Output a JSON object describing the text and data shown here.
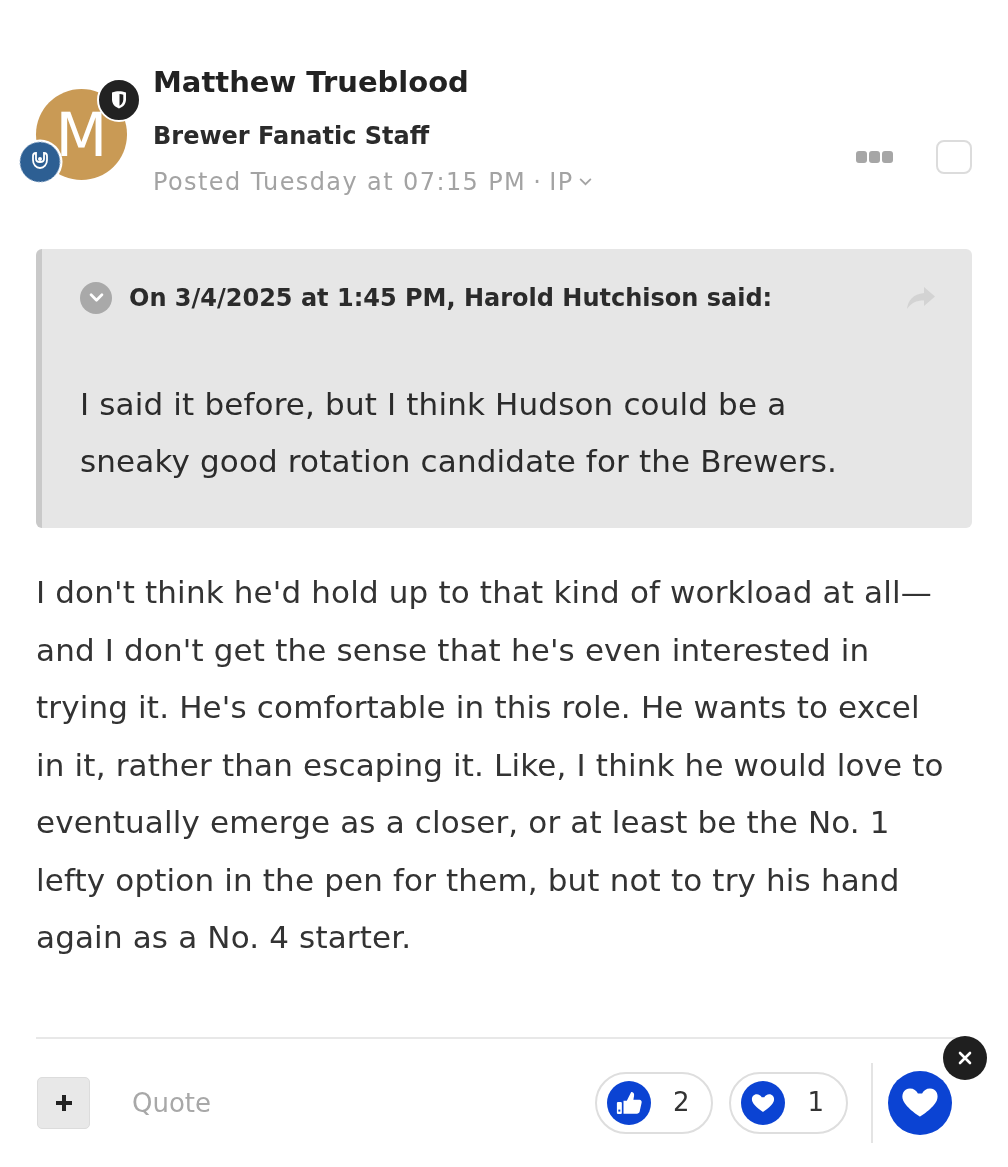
{
  "author": {
    "initial": "M",
    "name": "Matthew Trueblood",
    "role": "Brewer Fanatic Staff",
    "posted": "Posted Tuesday at 07:15 PM",
    "separator": "·",
    "ip": "IP"
  },
  "select": {
    "checked": false
  },
  "quote": {
    "citation": "On 3/4/2025 at 1:45 PM, Harold Hutchison said:",
    "text": "I said it before, but I think Hudson could be a sneaky good rotation candidate for the Brewers."
  },
  "body": "I don't think he'd hold up to that kind of workload at all—and I don't get the sense that he's even interested in trying it. He's comfortable in this role. He wants to excel in it, rather than escaping it. Like, I think he would love to eventually emerge as a closer, or at least be the No. 1 lefty option in the pen for them, but not to try his hand again as a No. 4 starter.",
  "footer": {
    "quote_label": "Quote",
    "reactions": [
      {
        "kind": "like",
        "count": "2"
      },
      {
        "kind": "heart",
        "count": "1"
      }
    ]
  }
}
